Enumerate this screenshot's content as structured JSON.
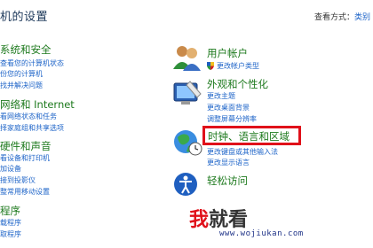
{
  "header": {
    "title": "机的设置",
    "view_by": "查看方式：",
    "view_mode": "类别"
  },
  "left_categories": [
    {
      "title": "系统和安全",
      "links": [
        "查看您的计算机状态",
        "份您的计算机",
        "找并解决问题"
      ]
    },
    {
      "title": "网络和 Internet",
      "links": [
        "看网络状态和任务",
        "择家庭组和共享选项"
      ]
    },
    {
      "title": "硬件和声音",
      "links": [
        "看设备和打印机",
        "加设备",
        "接到投影仪",
        "整常用移动设置"
      ]
    },
    {
      "title": "程序",
      "links": [
        "载程序",
        "取程序"
      ]
    }
  ],
  "right_categories": [
    {
      "title": "用户帐户",
      "links": [
        "更改帐户类型"
      ]
    },
    {
      "title": "外观和个性化",
      "links": [
        "更改主题",
        "更改桌面背景",
        "调整屏幕分辨率"
      ]
    },
    {
      "title": "时钟、语言和区域",
      "links": [
        "更改键盘或其他输入法",
        "更改显示语言"
      ]
    },
    {
      "title": "轻松访问",
      "links": []
    }
  ],
  "watermark": {
    "logo_main": "我",
    "logo_rest": "就看",
    "url": "www.wojiukan.com"
  },
  "colors": {
    "category_title": "#1e7a1e",
    "link": "#1e64c8",
    "highlight": "#e0101a"
  }
}
